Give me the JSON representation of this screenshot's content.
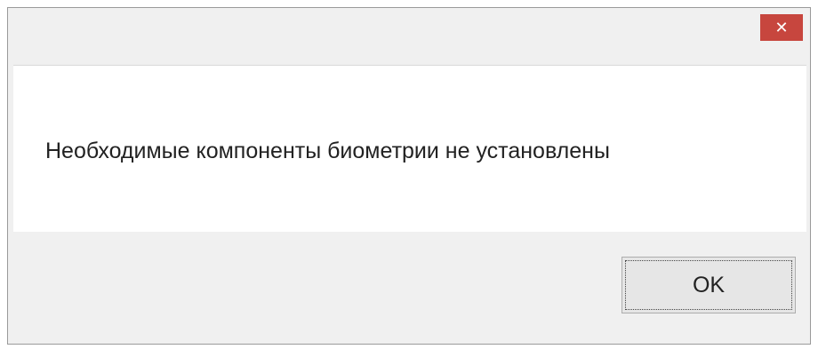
{
  "dialog": {
    "close_glyph": "✕",
    "close_color": "#c7463e",
    "message": "Необходимые компоненты биометрии не установлены",
    "ok_label": "OK"
  }
}
